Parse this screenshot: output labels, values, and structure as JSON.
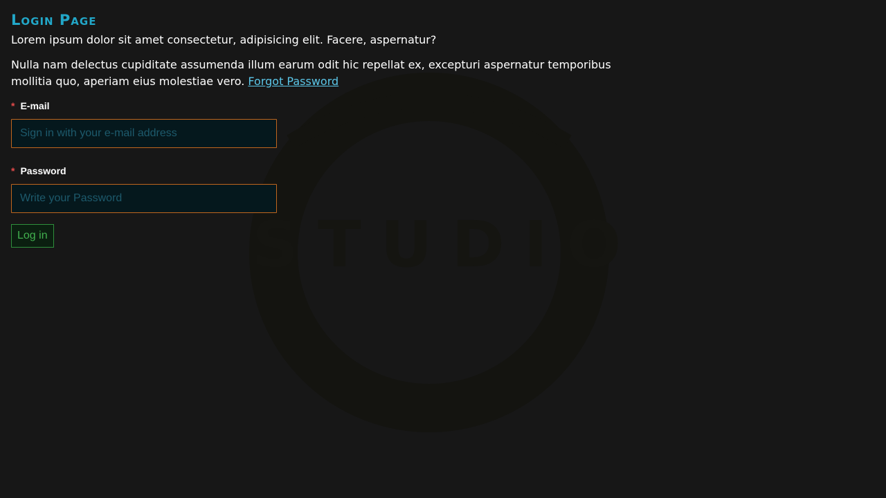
{
  "page": {
    "title": "Login Page",
    "intro": "Lorem ipsum dolor sit amet consectetur, adipisicing elit. Facere, aspernatur?",
    "body_text": "Nulla nam delectus cupiditate assumenda illum earum odit hic repellat ex, excepturi aspernatur temporibus mollitia quo, aperiam eius molestiae vero. ",
    "forgot_link": "Forgot Password"
  },
  "form": {
    "email": {
      "required_mark": "*",
      "label": "E-mail",
      "value": "",
      "placeholder": "Sign in with your e-mail address"
    },
    "password": {
      "required_mark": "*",
      "label": "Password",
      "value": "",
      "placeholder": "Write your Password"
    },
    "submit_label": "Log in"
  },
  "watermark": {
    "text": "STUDIO"
  },
  "colors": {
    "background": "#171717",
    "title": "#22a7c8",
    "link": "#5bc6e8",
    "input_border": "#c0661e",
    "button": "#42b04f",
    "required": "#e24a4a"
  }
}
